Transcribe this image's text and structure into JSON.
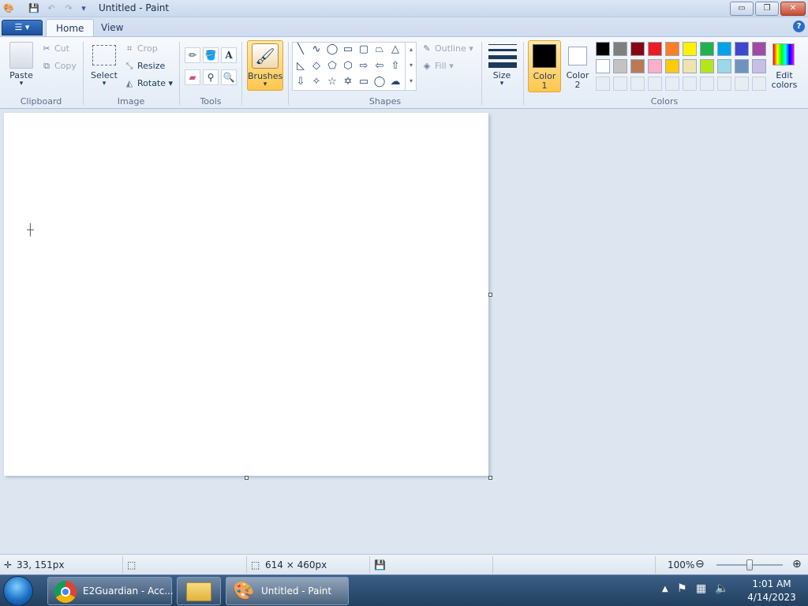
{
  "window": {
    "title": "Untitled - Paint",
    "minimize": "▭",
    "restore": "❐",
    "close": "✕"
  },
  "tabs": [
    {
      "label": "Home"
    },
    {
      "label": "View"
    }
  ],
  "ribbon": {
    "clipboard": {
      "label": "Clipboard",
      "paste": "Paste",
      "cut": "Cut",
      "copy": "Copy"
    },
    "image": {
      "label": "Image",
      "select": "Select",
      "crop": "Crop",
      "resize": "Resize",
      "rotate": "Rotate"
    },
    "tools": {
      "label": "Tools"
    },
    "brushes": {
      "label": "Brushes"
    },
    "shapes": {
      "label": "Shapes",
      "outline": "Outline",
      "fill": "Fill"
    },
    "size": {
      "label": "Size"
    },
    "color1": {
      "label_line1": "Color",
      "label_line2": "1",
      "value": "#000000"
    },
    "color2": {
      "label_line1": "Color",
      "label_line2": "2",
      "value": "#ffffff"
    },
    "colors": {
      "label": "Colors",
      "edit_line1": "Edit",
      "edit_line2": "colors",
      "palette_row1": [
        "#000000",
        "#7f7f7f",
        "#880015",
        "#ed1c24",
        "#ff7f27",
        "#fff200",
        "#22b14c",
        "#00a2e8",
        "#3f48cc",
        "#a349a4"
      ],
      "palette_row2": [
        "#ffffff",
        "#c3c3c3",
        "#b97a57",
        "#ffaec9",
        "#ffc90e",
        "#efe4b0",
        "#b5e61d",
        "#99d9ea",
        "#7092be",
        "#c8bfe7"
      ]
    }
  },
  "status": {
    "cursor_pos": "33, 151px",
    "image_size": "614 × 460px",
    "zoom": "100%",
    "zoom_slider": 0.5
  },
  "taskbar": {
    "items": [
      {
        "label": "E2Guardian - Acc..."
      },
      {
        "label": ""
      },
      {
        "label": "Untitled - Paint"
      }
    ],
    "time": "1:01 AM",
    "date": "4/14/2023"
  }
}
